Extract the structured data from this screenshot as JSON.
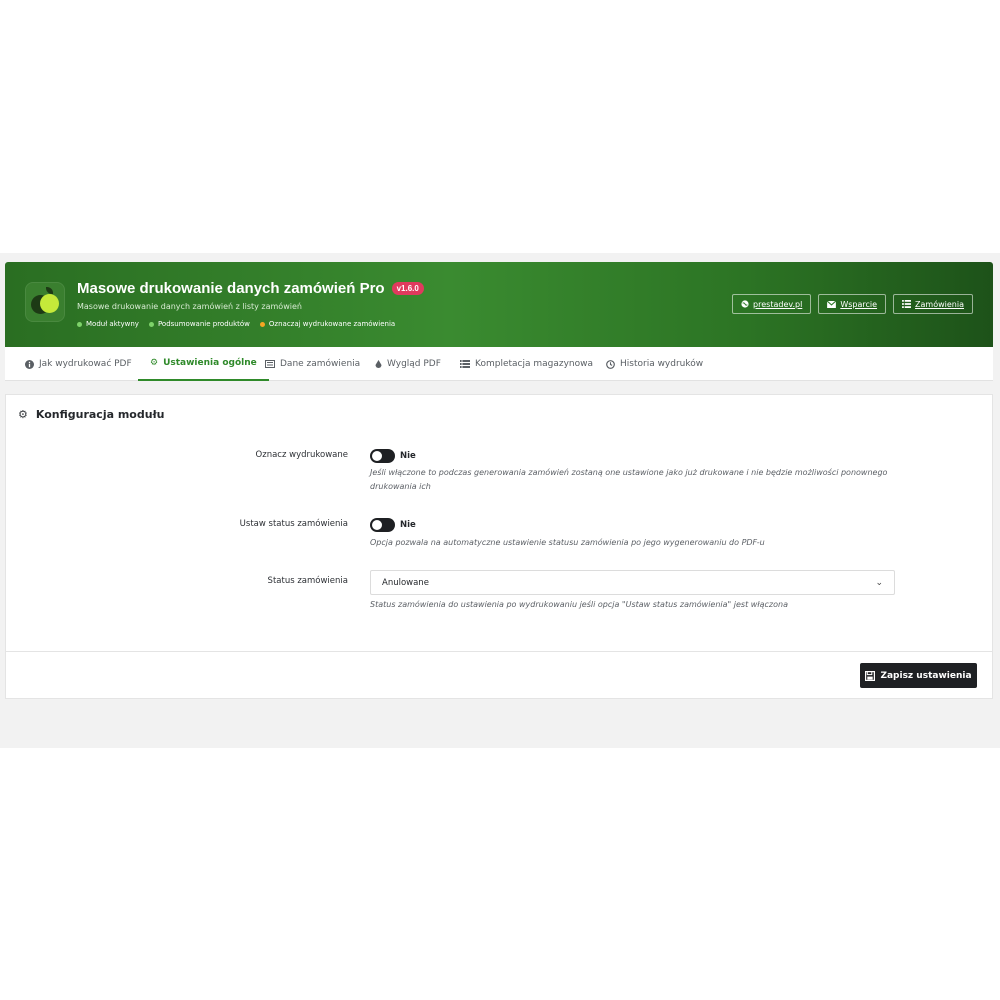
{
  "header": {
    "title": "Masowe drukowanie danych zamówień Pro",
    "version": "v1.6.0",
    "subtitle": "Masowe drukowanie danych zamówień z listy zamówień",
    "status": [
      {
        "label": "Moduł aktywny",
        "color": "#7ed36a"
      },
      {
        "label": "Podsumowanie produktów",
        "color": "#7ed36a"
      },
      {
        "label": "Oznaczaj wydrukowane zamówienia",
        "color": "#f5a623"
      }
    ],
    "links": [
      {
        "label": "prestadev.pl",
        "icon": "globe-icon"
      },
      {
        "label": "Wsparcie",
        "icon": "envelope-icon"
      },
      {
        "label": "Zamówienia",
        "icon": "list-icon"
      }
    ]
  },
  "tabs": [
    {
      "label": "Jak wydrukować PDF",
      "icon": "info-icon"
    },
    {
      "label": "Ustawienia ogólne",
      "icon": "cogs-icon",
      "active": true
    },
    {
      "label": "Dane zamówienia",
      "icon": "document-icon"
    },
    {
      "label": "Wygląd PDF",
      "icon": "drop-icon"
    },
    {
      "label": "Kompletacja magazynowa",
      "icon": "warehouse-icon"
    },
    {
      "label": "Historia wydruków",
      "icon": "history-icon"
    }
  ],
  "panel": {
    "title": "Konfiguracja modułu",
    "fields": [
      {
        "label": "Oznacz wydrukowane",
        "value": "Nie",
        "help": "Jeśli włączone to podczas generowania zamówień zostaną one ustawione jako już drukowane i nie będzie możliwości ponownego drukowania ich"
      },
      {
        "label": "Ustaw status zamówienia",
        "value": "Nie",
        "help": "Opcja pozwala na automatyczne ustawienie statusu zamówienia po jego wygenerowaniu do PDF-u"
      },
      {
        "label": "Status zamówienia",
        "value": "Anulowane",
        "help": "Status zamówienia do ustawienia po wydrukowaniu jeśli opcja \"Ustaw status zamówienia\" jest włączona"
      }
    ],
    "save_label": "Zapisz ustawienia"
  },
  "colors": {
    "brand_green": "#2f8a2a",
    "badge": "#e03a5e",
    "dark_button": "#1f2124"
  }
}
